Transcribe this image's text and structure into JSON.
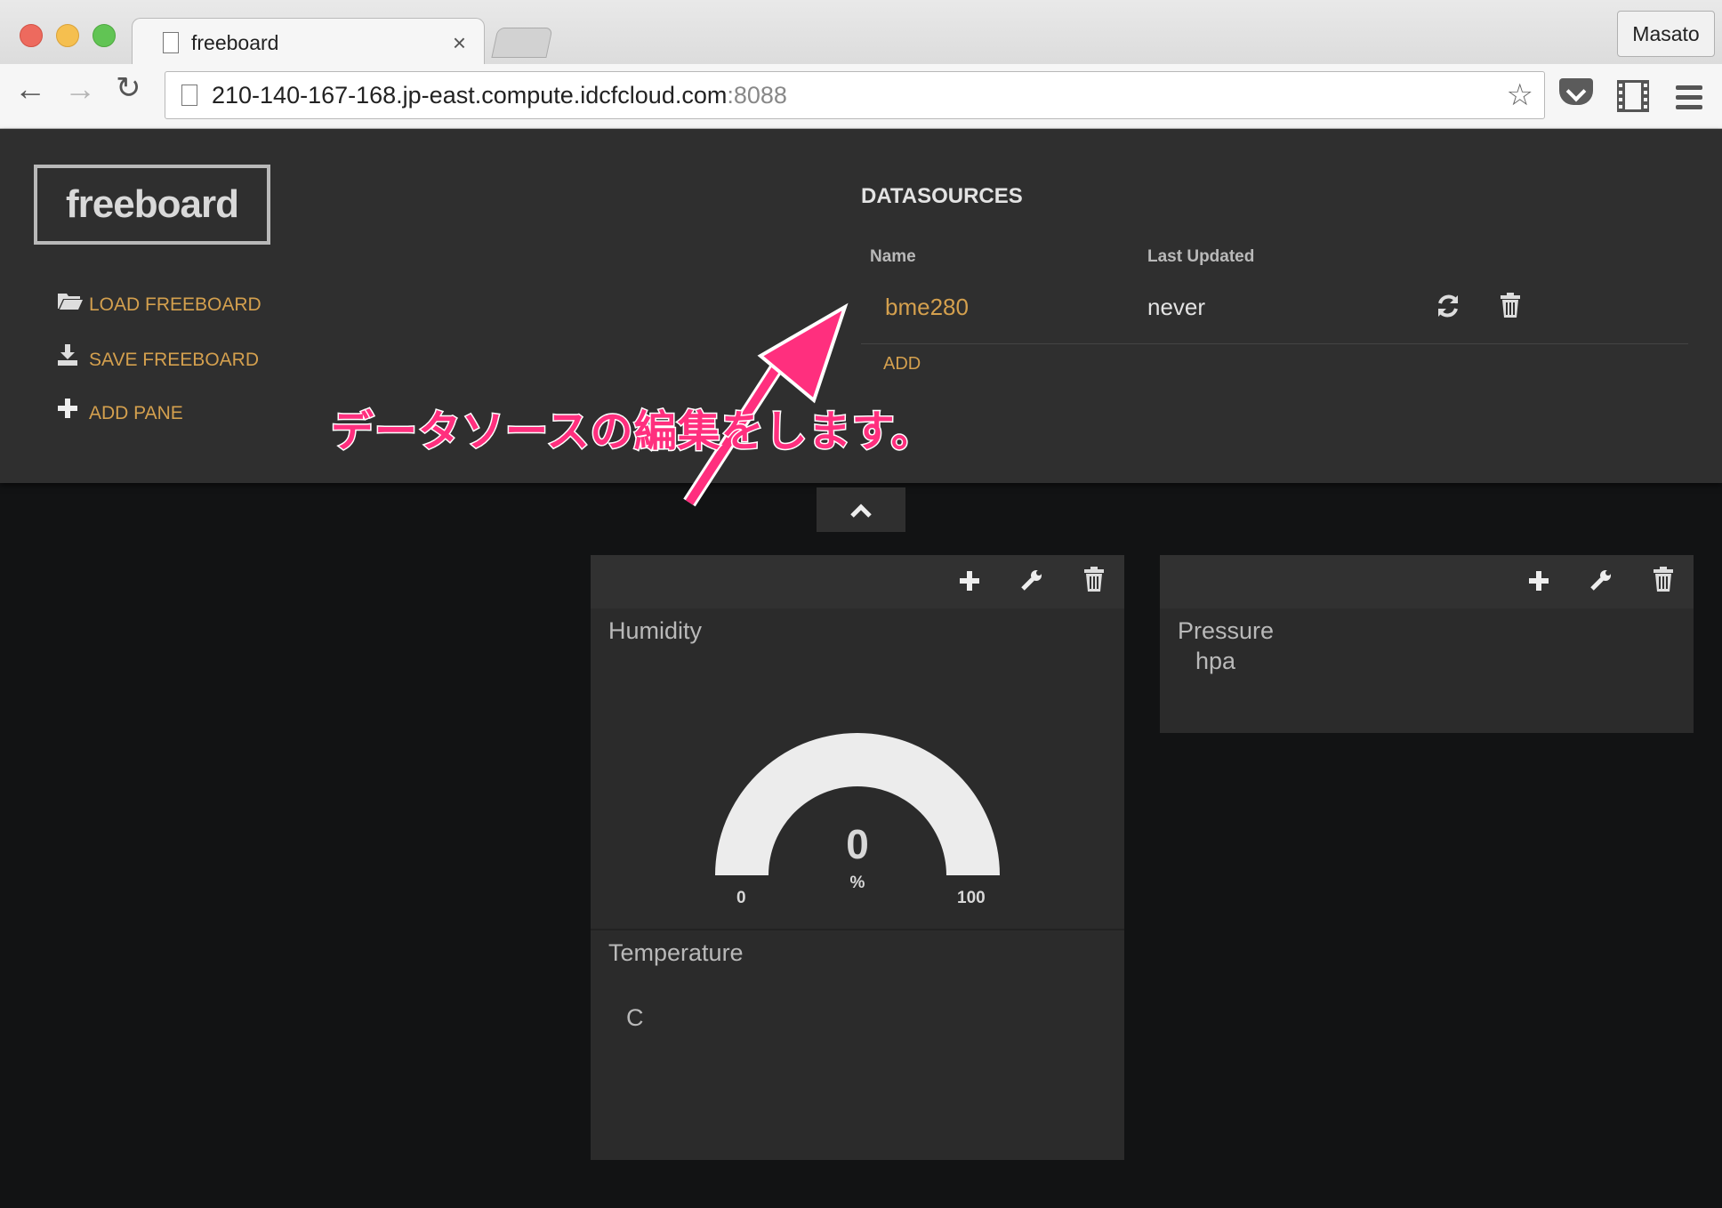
{
  "browser": {
    "tab_title": "freeboard",
    "tab_close": "×",
    "profile_name": "Masato",
    "url_host": "210-140-167-168.jp-east.compute.idcfcloud.com",
    "url_port": ":8088",
    "icons": [
      "back-icon",
      "forward-icon",
      "reload-icon",
      "bookmark-star-icon",
      "pocket-icon",
      "filmstrip-icon",
      "menu-icon"
    ]
  },
  "freeboard": {
    "logo": "freeboard",
    "menu": {
      "load": "LOAD FREEBOARD",
      "save": "SAVE FREEBOARD",
      "add_pane": "ADD PANE"
    },
    "datasources": {
      "title": "DATASOURCES",
      "col_name": "Name",
      "col_updated": "Last Updated",
      "rows": [
        {
          "name": "bme280",
          "last_updated": "never"
        }
      ],
      "add": "ADD"
    },
    "annotation": "データソースの編集をします。",
    "accent_color": "#d4a04e",
    "annotation_color": "#ff2f7e"
  },
  "panes": [
    {
      "widgets": [
        {
          "title": "Humidity",
          "type": "gauge",
          "value": "0",
          "units": "%",
          "min": "0",
          "max": "100",
          "fill_fraction": 0
        },
        {
          "title": "Temperature",
          "type": "text",
          "value": "",
          "units": "C"
        }
      ]
    },
    {
      "widgets": [
        {
          "title": "Pressure",
          "type": "text",
          "value": "",
          "units": "hpa"
        }
      ]
    }
  ]
}
